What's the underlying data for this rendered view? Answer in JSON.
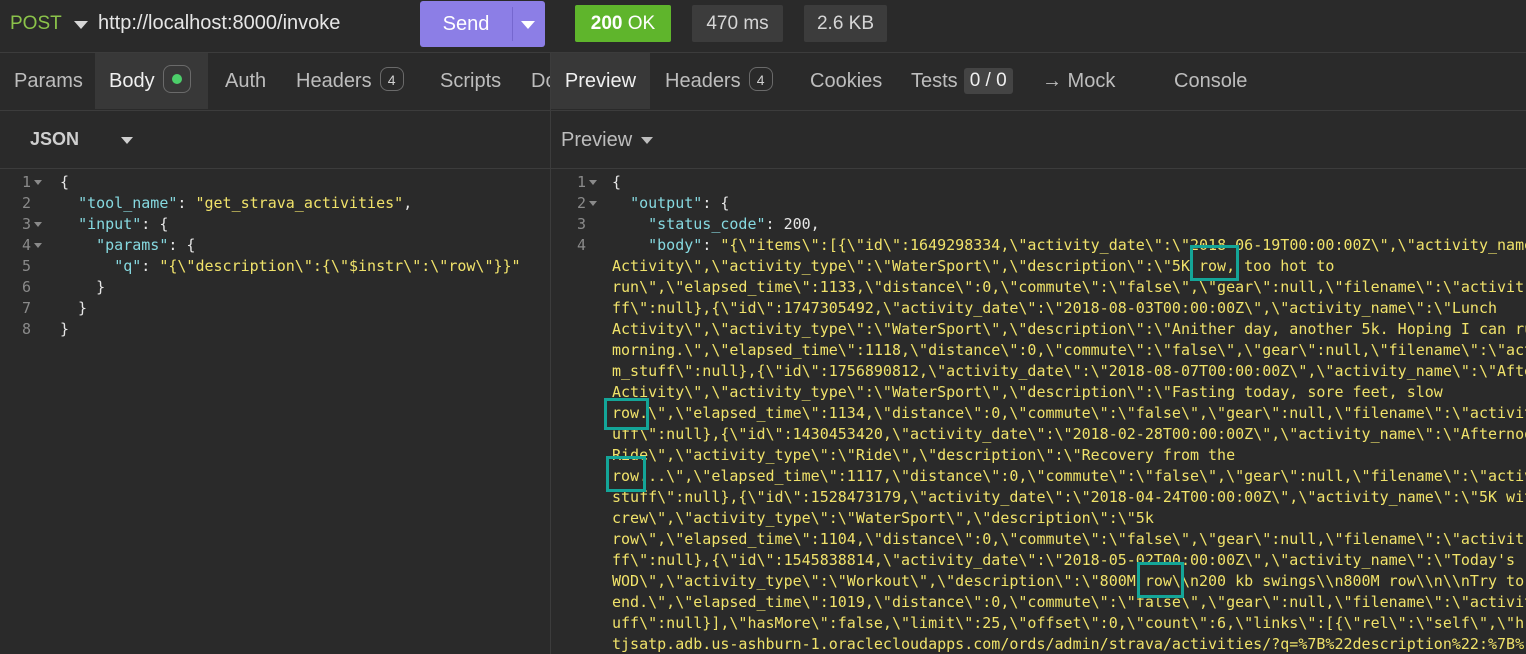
{
  "request": {
    "method": "POST",
    "url": "http://localhost:8000/invoke",
    "send_label": "Send"
  },
  "response_status": {
    "code": "200",
    "text": "OK",
    "time": "470 ms",
    "size": "2.6 KB"
  },
  "request_tabs": [
    {
      "label": "Params"
    },
    {
      "label": "Body"
    },
    {
      "label": "Auth"
    },
    {
      "label": "Headers",
      "badge": "4"
    },
    {
      "label": "Scripts"
    },
    {
      "label": "Do"
    }
  ],
  "response_tabs": [
    {
      "label": "Preview"
    },
    {
      "label": "Headers",
      "badge": "4"
    },
    {
      "label": "Cookies"
    },
    {
      "label": "Tests",
      "badge": "0 / 0"
    },
    {
      "label": "→ Mock"
    },
    {
      "label": "Console"
    }
  ],
  "body_format": "JSON",
  "preview_mode": "Preview",
  "request_body_lines": [
    "{",
    "  \"tool_name\": \"get_strava_activities\",",
    "  \"input\": {",
    "    \"params\": {",
    "      \"q\": \"{\\\"description\\\":{\\\"$instr\\\":\\\"row\\\"}}\"",
    "    }",
    "  }",
    "}"
  ],
  "response_lines": [
    "{",
    "  \"output\": {",
    "    \"status_code\": 200,",
    "    \"body\": \"{\\\"items\\\":[{\\\"id\\\":1649298334,\\\"activity_date\\\":\\\"2018-06-19T00:00:00Z\\\",\\\"activity_name",
    "Activity\\\",\\\"activity_type\\\":\\\"WaterSport\\\",\\\"description\\\":\\\"5K row, too hot to",
    "run\\\",\\\"elapsed_time\\\":1133,\\\"distance\\\":0,\\\"commute\\\":\\\"false\\\",\\\"gear\\\":null,\\\"filename\\\":\\\"activit",
    "ff\\\":null},{\\\"id\\\":1747305492,\\\"activity_date\\\":\\\"2018-08-03T00:00:00Z\\\",\\\"activity_name\\\":\\\"Lunch",
    "Activity\\\",\\\"activity_type\\\":\\\"WaterSport\\\",\\\"description\\\":\\\"Anither day, another 5k. Hoping I can ru",
    "morning.\\\",\\\"elapsed_time\\\":1118,\\\"distance\\\":0,\\\"commute\\\":\\\"false\\\",\\\"gear\\\":null,\\\"filename\\\":\\\"act",
    "m_stuff\\\":null},{\\\"id\\\":1756890812,\\\"activity_date\\\":\\\"2018-08-07T00:00:00Z\\\",\\\"activity_name\\\":\\\"Afte",
    "Activity\\\",\\\"activity_type\\\":\\\"WaterSport\\\",\\\"description\\\":\\\"Fasting today, sore feet, slow",
    "row.\\\",\\\"elapsed_time\\\":1134,\\\"distance\\\":0,\\\"commute\\\":\\\"false\\\",\\\"gear\\\":null,\\\"filename\\\":\\\"activit",
    "uff\\\":null},{\\\"id\\\":1430453420,\\\"activity_date\\\":\\\"2018-02-28T00:00:00Z\\\",\\\"activity_name\\\":\\\"Afternoo",
    "Ride\\\",\\\"activity_type\\\":\\\"Ride\\\",\\\"description\\\":\\\"Recovery from the",
    "row...\\\",\\\"elapsed_time\\\":1117,\\\"distance\\\":0,\\\"commute\\\":\\\"false\\\",\\\"gear\\\":null,\\\"filename\\\":\\\"activ",
    "stuff\\\":null},{\\\"id\\\":1528473179,\\\"activity_date\\\":\\\"2018-04-24T00:00:00Z\\\",\\\"activity_name\\\":\\\"5K wit",
    "crew\\\",\\\"activity_type\\\":\\\"WaterSport\\\",\\\"description\\\":\\\"5k",
    "row\\\",\\\"elapsed_time\\\":1104,\\\"distance\\\":0,\\\"commute\\\":\\\"false\\\",\\\"gear\\\":null,\\\"filename\\\":\\\"activit",
    "ff\\\":null},{\\\"id\\\":1545838814,\\\"activity_date\\\":\\\"2018-05-02T00:00:00Z\\\",\\\"activity_name\\\":\\\"Today's",
    "WOD\\\",\\\"activity_type\\\":\\\"Workout\\\",\\\"description\\\":\\\"800M row\\\\n200 kb swings\\\\n800M row\\\\n\\\\nTry to",
    "end.\\\",\\\"elapsed_time\\\":1019,\\\"distance\\\":0,\\\"commute\\\":\\\"false\\\",\\\"gear\\\":null,\\\"filename\\\":\\\"activit",
    "uff\\\":null}],\\\"hasMore\\\":false,\\\"limit\\\":25,\\\"offset\\\":0,\\\"count\\\":6,\\\"links\\\":[{\\\"rel\\\":\\\"self\\\",\\\"hr",
    "tjsatp.adb.us-ashburn-1.oraclecloudapps.com/ords/admin/strava/activities/?q=%7B%22description%22:%7B%"
  ],
  "colors": {
    "method": "#8bc34a",
    "send_button": "#8c7ee6",
    "status_ok": "#5fb52c",
    "highlight_box": "#14a598",
    "json_key": "#86d9e0",
    "json_string": "#f0e26a"
  }
}
